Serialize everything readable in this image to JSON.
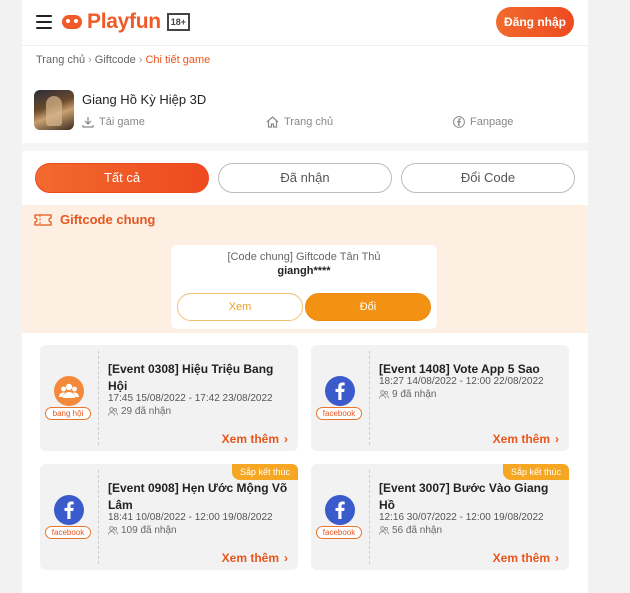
{
  "header": {
    "brand": "Playfun",
    "age_rating": "18+",
    "login_label": "Đăng nhập"
  },
  "breadcrumb": [
    "Trang chủ",
    "Giftcode",
    "Chi tiết game"
  ],
  "game": {
    "title": "Giang Hồ Kỳ Hiệp 3D",
    "links": [
      "Tải game",
      "Trang chủ",
      "Fanpage"
    ]
  },
  "tabs": [
    "Tất cả",
    "Đã nhận",
    "Đổi Code"
  ],
  "active_tab": "Tất cả",
  "giftcode_chung": {
    "heading": "Giftcode chung",
    "type_label": "[Code chung] Giftcode Tân Thủ",
    "code": "giangh****",
    "view_label": "Xem",
    "swap_label": "Đổi"
  },
  "events": [
    {
      "title": "[Event 0308] Hiệu Triệu Bang Hội",
      "time": "17:45 15/08/2022 - 17:42 23/08/2022",
      "count": "29 đã nhận",
      "source": "bang hội",
      "icon": "guild-icon",
      "more": "Xem thêm",
      "badge": ""
    },
    {
      "title": "[Event 1408] Vote App 5 Sao",
      "time": "18:27 14/08/2022 - 12:00 22/08/2022",
      "count": "9 đã nhận",
      "source": "facebook",
      "icon": "facebook-icon",
      "more": "Xem thêm",
      "badge": ""
    },
    {
      "title": "[Event 0908] Hẹn Ước Mộng Võ Lâm",
      "time": "18:41 10/08/2022 - 12:00 19/08/2022",
      "count": "109 đã nhận",
      "source": "facebook",
      "icon": "facebook-icon",
      "more": "Xem thêm",
      "badge": "Sắp kết thúc"
    },
    {
      "title": "[Event 3007] Bước Vào Giang Hồ",
      "time": "12:16 30/07/2022 - 12:00 19/08/2022",
      "count": "56 đã nhận",
      "source": "facebook",
      "icon": "facebook-icon",
      "more": "Xem thêm",
      "badge": "Sắp kết thúc"
    }
  ],
  "colors": {
    "accent": "#ee4a1f",
    "light_section": "#fdefe2",
    "swap_button": "#f39212",
    "badge": "#f5a623",
    "facebook": "#3b5bcc"
  }
}
